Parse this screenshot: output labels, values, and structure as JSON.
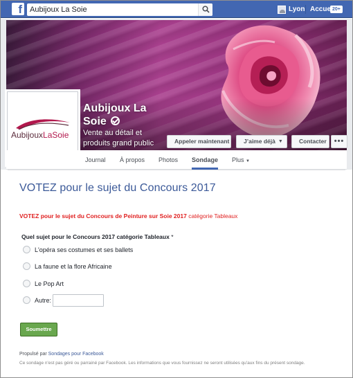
{
  "topbar": {
    "search_value": "Aubijoux La Soie",
    "user_label": "Lyon",
    "home_label": "Accueil",
    "badge_count": "20+"
  },
  "page": {
    "name": "Aubijoux La Soie",
    "category": "Vente au détail et produits grand public",
    "logo_text_part1": "Aubijoux",
    "logo_text_part2": "LaSoie"
  },
  "actions": {
    "call_label": "Appeler maintenant",
    "like_label": "J’aime déjà",
    "contact_label": "Contacter",
    "more_label": "•••"
  },
  "tabs": [
    {
      "label": "Journal"
    },
    {
      "label": "À propos"
    },
    {
      "label": "Photos"
    },
    {
      "label": "Sondage"
    },
    {
      "label": "Plus"
    }
  ],
  "form": {
    "title": "VOTEZ pour le sujet du Concours 2017",
    "subtitle_bold": "VOTEZ pour le sujet du Concours de Peinture sur Soie 2017",
    "subtitle_rest": " catégorie Tableaux",
    "question": "Quel sujet pour le Concours 2017 catégorie Tableaux",
    "required_mark": "*",
    "options": [
      {
        "label": "L'opéra ses costumes et ses ballets"
      },
      {
        "label": "La faune et la flore Africaine"
      },
      {
        "label": "Le Pop Art"
      },
      {
        "label": "Autre:"
      }
    ],
    "submit_label": "Soumettre",
    "powered_prefix": "Propulsé par ",
    "powered_link": "Sondages pour Facebook",
    "disclaimer": "Ce sondage n'est pas géré ou parrainé par Facebook. Les informations que vous fournissez ne seront utilisées qu'aux fins du présent sondage."
  },
  "colors": {
    "facebook_blue": "#4267b2",
    "title_blue": "#3b5998",
    "subtitle_red": "#e02020",
    "submit_green": "#69a74e",
    "cover_purple": "#a9408e",
    "rose_pink": "#d93a78"
  }
}
